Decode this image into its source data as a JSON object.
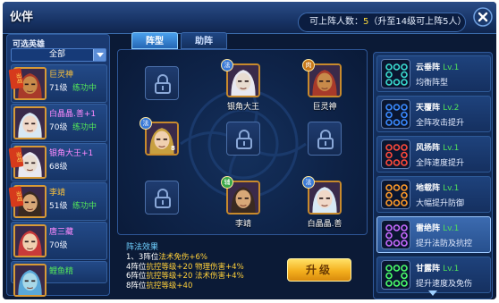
{
  "window": {
    "title": "伙伴"
  },
  "deploy_info": {
    "label": "可上阵人数：",
    "value": "5",
    "note": "（升至14级可上阵5人）"
  },
  "colors": {
    "accent": "#4aa0ec",
    "gold": "#ffd03a",
    "status_green": "#54e85a",
    "badge_red": "#d63a1c"
  },
  "hero_panel": {
    "title": "可选英雄",
    "filter": {
      "selected": "全部"
    },
    "heroes": [
      {
        "name": "巨灵神",
        "level": "71级",
        "status": "练功中",
        "badge": "出战",
        "name_color": "#ffc43a",
        "skin": "#c88a4a",
        "hair": "#a83a2a"
      },
      {
        "name": "白晶晶.善+1",
        "level": "70级",
        "status": "练功中",
        "badge": "",
        "name_color": "#ff8aff",
        "skin": "#f0d8c8",
        "hair": "#d8e8f4"
      },
      {
        "name": "银角大王+1",
        "level": "68级",
        "status": "",
        "badge": "出战",
        "name_color": "#ff8aff",
        "skin": "#e8dcd0",
        "hair": "#e8e8f0"
      },
      {
        "name": "李靖",
        "level": "51级",
        "status": "练功中",
        "badge": "出战",
        "name_color": "#ffc43a",
        "skin": "#d8a878",
        "hair": "#3a2a20"
      },
      {
        "name": "唐三藏",
        "level": "70级",
        "status": "",
        "badge": "",
        "name_color": "#ff8aff",
        "skin": "#f0d0b0",
        "hair": "#c83a3a"
      },
      {
        "name": "鲤鱼精",
        "level": "",
        "status": "",
        "badge": "",
        "name_color": "#54e85a",
        "skin": "#a8d8e8",
        "hair": "#5aa8d8"
      }
    ]
  },
  "tabs": [
    {
      "label": "阵型"
    },
    {
      "label": "助阵"
    }
  ],
  "board": {
    "slots": [
      {
        "type": "hero",
        "name": "银角大王",
        "badge": "法",
        "badge_color": "#3a7ad8",
        "index": "",
        "skin": "#e8dcd0",
        "hair": "#e8e8f0"
      },
      {
        "type": "hero",
        "name": "巨灵神",
        "badge": "肉",
        "badge_color": "#c8781a",
        "index": "",
        "skin": "#c88a4a",
        "hair": "#a83a2a"
      },
      {
        "type": "hero",
        "name": "",
        "badge": "法",
        "badge_color": "#3a7ad8",
        "index": "8",
        "skin": "#f0d0b0",
        "hair": "#c8a040"
      },
      {
        "type": "hero",
        "name": "李靖",
        "badge": "辅",
        "badge_color": "#3aa84a",
        "index": "",
        "skin": "#d8a878",
        "hair": "#3a2a20"
      },
      {
        "type": "hero",
        "name": "白晶晶.善",
        "badge": "法",
        "badge_color": "#3a7ad8",
        "index": "",
        "skin": "#f0d8c8",
        "hair": "#d8e8f4"
      }
    ]
  },
  "effects": {
    "title": "阵法效果",
    "lines": [
      {
        "pos": "1、3阵位",
        "text": "法术免伤+6%"
      },
      {
        "pos": "4阵位",
        "text": "抗控等级+20 物理伤害+4%"
      },
      {
        "pos": "6阵位",
        "text": "抗控等级+20 法术伤害+4%"
      },
      {
        "pos": "8阵位",
        "text": "抗控等级+40"
      }
    ]
  },
  "upgrade_button": {
    "label": "升级"
  },
  "formations": [
    {
      "name": "云垂阵",
      "level": "Lv.1",
      "desc": "均衡阵型",
      "icon_color": "#3adcd0",
      "selected": false
    },
    {
      "name": "天覆阵",
      "level": "Lv.2",
      "desc": "全阵攻击提升",
      "icon_color": "#3a8aff",
      "selected": false
    },
    {
      "name": "风扬阵",
      "level": "Lv.1",
      "desc": "全阵速度提升",
      "icon_color": "#ff4a3a",
      "selected": false
    },
    {
      "name": "地载阵",
      "level": "Lv.1",
      "desc": "大幅提升防御",
      "icon_color": "#ff9a2a",
      "selected": false
    },
    {
      "name": "雷绝阵",
      "level": "Lv.1",
      "desc": "提升法防及抗控",
      "icon_color": "#c86aff",
      "selected": true
    },
    {
      "name": "甘露阵",
      "level": "Lv.1",
      "desc": "提升速度及免伤",
      "icon_color": "#4aff6a",
      "selected": false
    }
  ]
}
